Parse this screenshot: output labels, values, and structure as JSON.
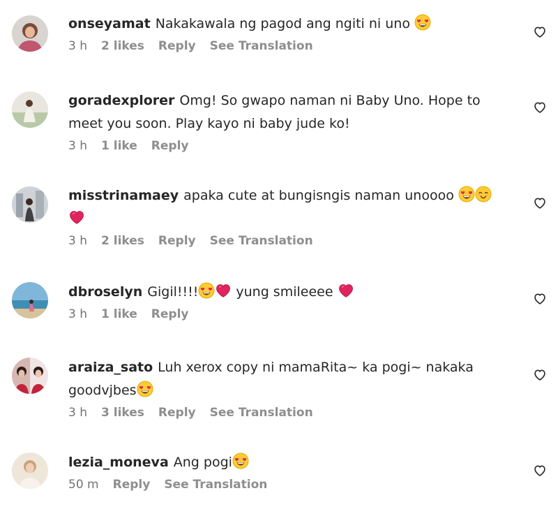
{
  "comments": [
    {
      "username": "onseyamat",
      "text": "Nakakawala ng pagod ang ngiti ni uno",
      "emojis_after_text": [
        "heart-eyes-emoji"
      ],
      "time": "3 h",
      "likes": "2 likes",
      "reply": "Reply",
      "translation": "See Translation"
    },
    {
      "username": "goradexplorer",
      "text": "Omg! So gwapo naman ni Baby Uno. Hope to meet you soon. Play kayo ni baby jude ko!",
      "emojis_after_text": [],
      "time": "3 h",
      "likes": "1 like",
      "reply": "Reply",
      "translation": ""
    },
    {
      "username": "misstrinamaey",
      "text": "apaka cute at bungisngis naman unoooo",
      "emojis_after_text": [
        "heart-eyes-emoji",
        "smiling-blush-emoji",
        "red-heart-emoji"
      ],
      "time": "3 h",
      "likes": "2 likes",
      "reply": "Reply",
      "translation": "See Translation"
    },
    {
      "username": "dbroselyn",
      "text_before": "Gigil!!!!",
      "text_after": " yung smileeee",
      "time": "3 h",
      "likes": "1 like",
      "reply": "Reply",
      "translation": ""
    },
    {
      "username": "araiza_sato",
      "text": "Luh xerox copy ni mamaRita~ ka pogi~ nakaka goodvjbes",
      "emojis_after_text": [
        "heart-eyes-emoji"
      ],
      "time": "3 h",
      "likes": "3 likes",
      "reply": "Reply",
      "translation": "See Translation"
    },
    {
      "username": "lezia_moneva",
      "text": "Ang pogi",
      "emojis_after_text": [
        "heart-eyes-emoji"
      ],
      "time": "50 m",
      "likes": "",
      "reply": "Reply",
      "translation": "See Translation"
    }
  ],
  "colors": {
    "text": "#262626",
    "meta": "#8e8e8e",
    "heart_outline": "#262626",
    "red_heart": "#e0245e",
    "emoji_yellow": "#ffcc33"
  }
}
